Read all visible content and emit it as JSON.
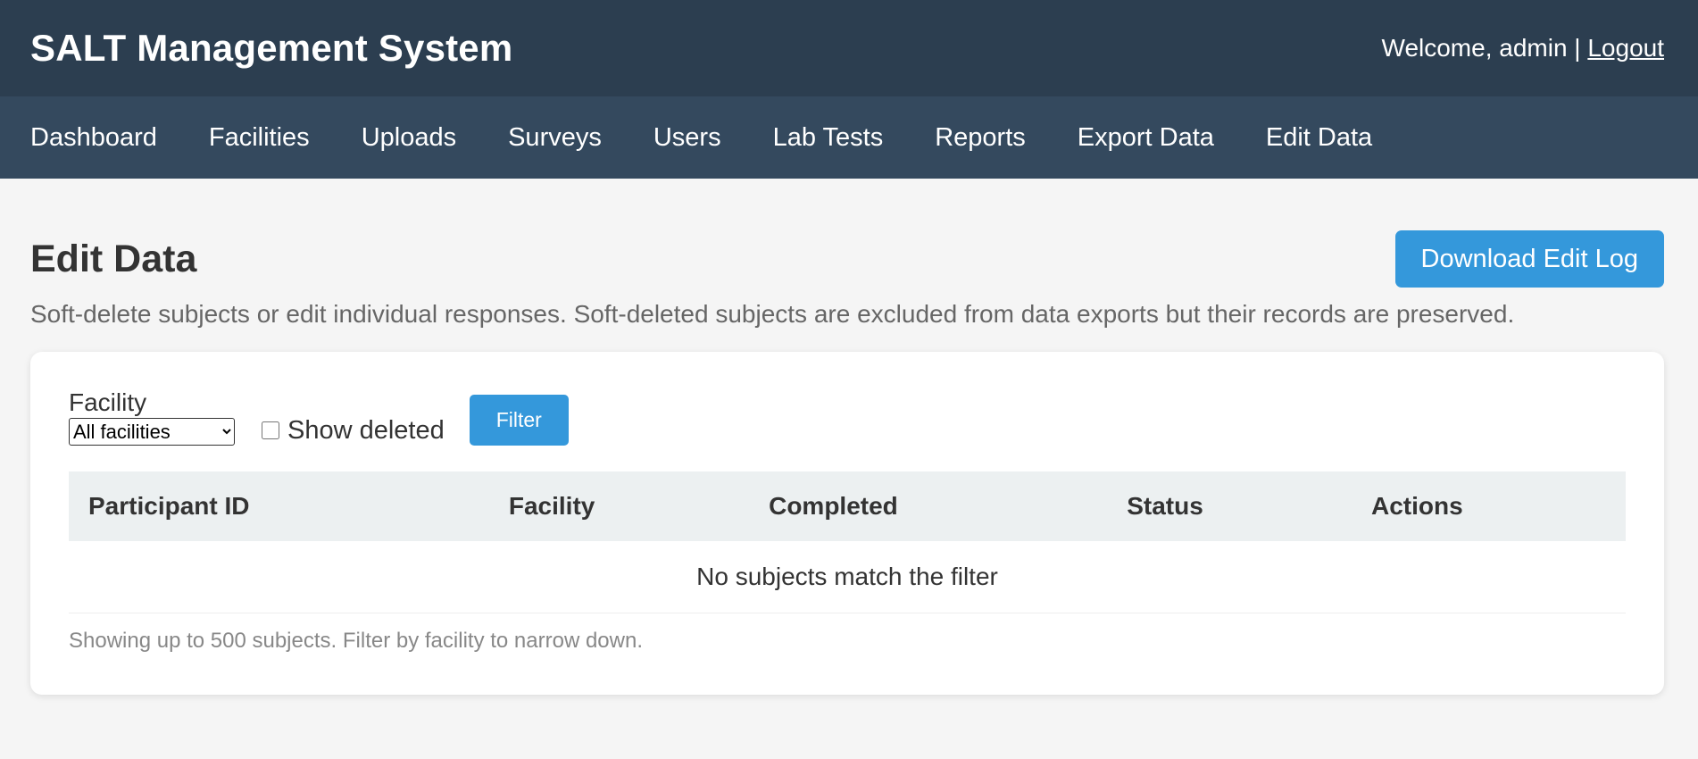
{
  "header": {
    "brand": "SALT Management System",
    "welcome": "Welcome, admin |",
    "logout": "Logout"
  },
  "nav": {
    "items": [
      "Dashboard",
      "Facilities",
      "Uploads",
      "Surveys",
      "Users",
      "Lab Tests",
      "Reports",
      "Export Data",
      "Edit Data"
    ]
  },
  "page": {
    "title": "Edit Data",
    "download_button": "Download Edit Log",
    "subtitle": "Soft-delete subjects or edit individual responses. Soft-deleted subjects are excluded from data exports but their records are preserved."
  },
  "filters": {
    "facility_label": "Facility",
    "facility_selected": "All facilities",
    "show_deleted_label": "Show deleted",
    "show_deleted_checked": false,
    "filter_button": "Filter"
  },
  "table": {
    "columns": [
      "Participant ID",
      "Facility",
      "Completed",
      "Status",
      "Actions"
    ],
    "empty_message": "No subjects match the filter",
    "footnote": "Showing up to 500 subjects. Filter by facility to narrow down."
  },
  "colors": {
    "header_bg": "#2c3e50",
    "nav_bg": "#34495e",
    "accent": "#3498db",
    "page_bg": "#f5f5f5"
  }
}
